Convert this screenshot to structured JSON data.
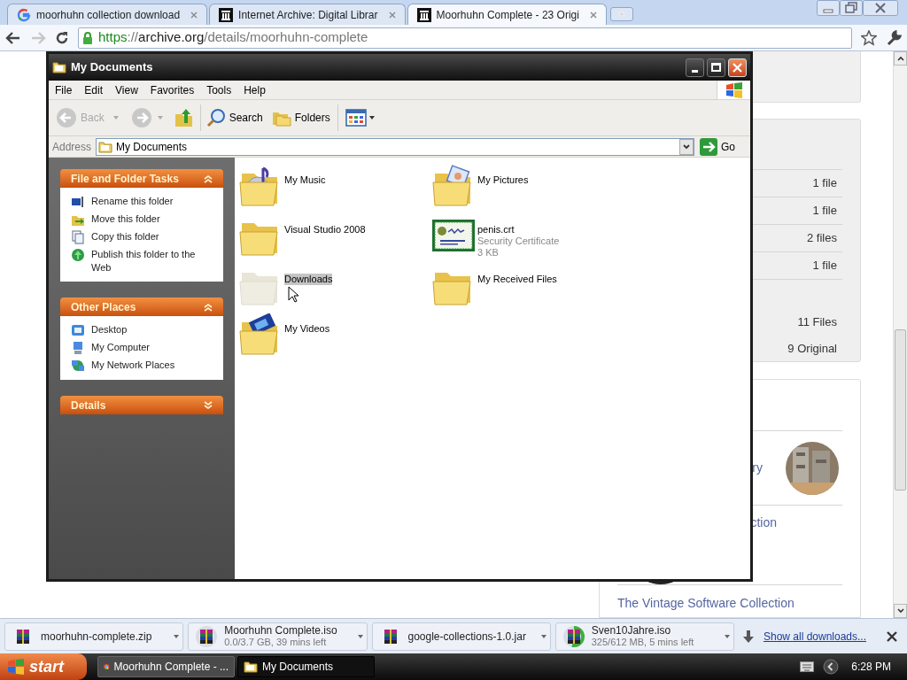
{
  "browser": {
    "tabs": [
      {
        "title": "moorhuhn collection download",
        "selected": false
      },
      {
        "title": "Internet Archive: Digital Librar",
        "selected": false
      },
      {
        "title": "Moorhuhn Complete - 23 Origi",
        "selected": true
      }
    ],
    "forward": {
      "disabled": true
    },
    "url": [
      {
        "text": "https",
        "kind": "scheme"
      },
      {
        "text": "://",
        "kind": "muted"
      },
      {
        "text": "archive.org",
        "kind": "host"
      },
      {
        "text": "/details/moorhuhn-complete",
        "kind": "muted"
      }
    ]
  },
  "page": {
    "file_counts": [
      "1 file",
      "1 file",
      "2 files",
      "1 file"
    ],
    "totals": [
      "11 Files",
      "9 Original"
    ],
    "collections": [
      {
        "text": "ry"
      },
      {
        "text": "ction",
        "kind": "plain"
      },
      {
        "text": "The Vintage Software Collection",
        "kind": "logo"
      }
    ]
  },
  "explorer": {
    "title": "My Documents",
    "menu": [
      "File",
      "Edit",
      "View",
      "Favorites",
      "Tools",
      "Help"
    ],
    "toolbar": {
      "back": {
        "label": "Back",
        "disabled": true
      },
      "forward": {
        "disabled": true
      },
      "search": "Search",
      "folders": "Folders"
    },
    "address": {
      "label": "Address",
      "value": "My Documents",
      "go": "Go"
    },
    "panels": [
      {
        "title": "File and Folder Tasks",
        "expanded": true,
        "items": [
          "Rename this folder",
          "Move this folder",
          "Copy this folder",
          "Publish this folder to the Web"
        ]
      },
      {
        "title": "Other Places",
        "expanded": true,
        "items": [
          "Desktop",
          "My Computer",
          "My Network Places"
        ]
      },
      {
        "title": "Details",
        "expanded": false
      }
    ],
    "items": [
      {
        "name": "My Music",
        "kind": "music",
        "selected": false,
        "dimmed": false
      },
      {
        "name": "My Pictures",
        "kind": "pictures",
        "selected": false,
        "dimmed": false
      },
      {
        "name": "Visual Studio 2008",
        "kind": "folder",
        "selected": false,
        "dimmed": false
      },
      {
        "name": "penis.crt",
        "details": [
          "Security Certificate",
          "3 KB"
        ],
        "kind": "certificate",
        "selected": false,
        "dimmed": false
      },
      {
        "name": "Downloads",
        "kind": "folder",
        "selected": true,
        "dimmed": true
      },
      {
        "name": "My Received Files",
        "kind": "folder",
        "selected": false,
        "dimmed": false
      },
      {
        "name": "My Videos",
        "kind": "videos",
        "selected": false,
        "dimmed": false
      }
    ]
  },
  "downloads": {
    "items": [
      {
        "name": "moorhuhn-complete.zip",
        "kind": "done"
      },
      {
        "name": "Moorhuhn Complete.iso",
        "status": "0.0/3.7 GB, 39 mins left",
        "kind": "progress"
      },
      {
        "name": "google-collections-1.0.jar",
        "kind": "done"
      },
      {
        "name": "Sven10Jahre.iso",
        "status": "325/612 MB, 5 mins left",
        "kind": "progress"
      }
    ],
    "show_all": "Show all downloads..."
  },
  "taskbar": {
    "start": "start",
    "tasks": [
      {
        "label": "Moorhuhn Complete - ...",
        "selected": false
      },
      {
        "label": "My Documents",
        "selected": true
      }
    ],
    "clock": "6:28 PM"
  }
}
